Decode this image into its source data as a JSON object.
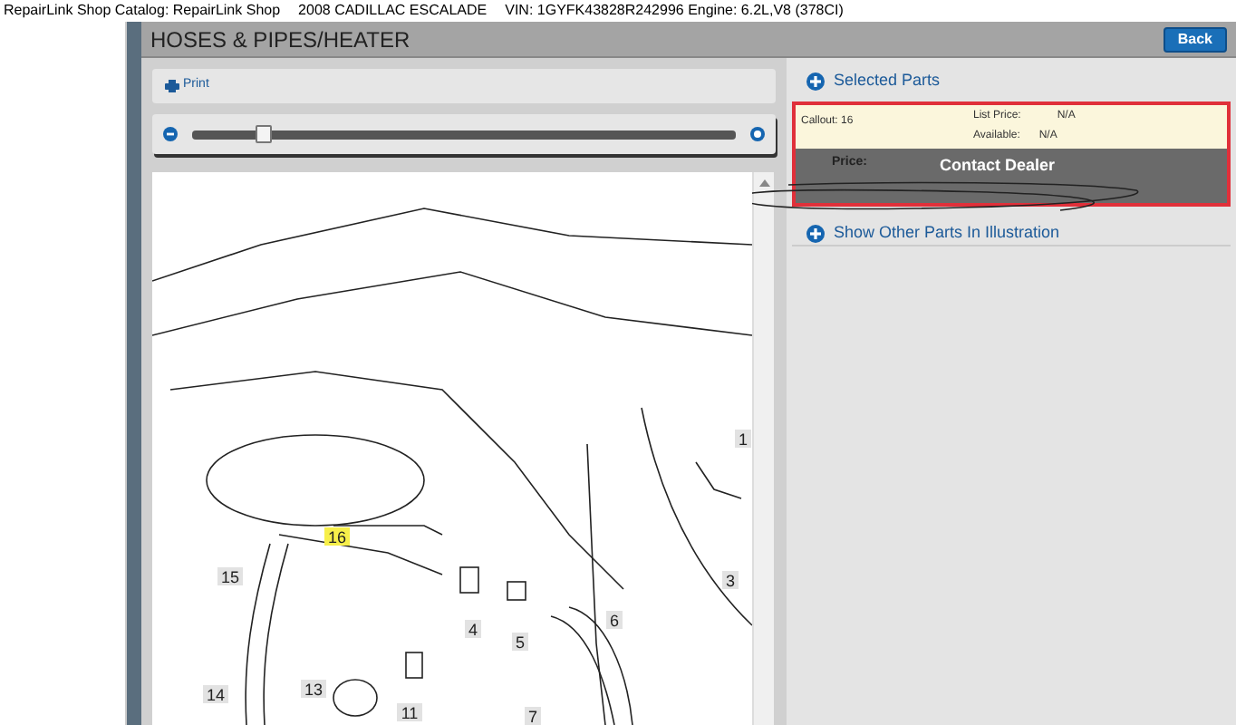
{
  "title_bar": {
    "catalog": "RepairLink Shop Catalog: RepairLink Shop",
    "vehicle": "2008 CADILLAC ESCALADE",
    "vin": "VIN: 1GYFK43828R242996 Engine: 6.2L,V8 (378CI)"
  },
  "header": {
    "title": "HOSES & PIPES/HEATER",
    "back_button": "Back"
  },
  "toolbar": {
    "print": "Print"
  },
  "zoom_slider": {
    "level": 0.13
  },
  "callouts": [
    {
      "label": "1",
      "highlighted": false
    },
    {
      "label": "16",
      "highlighted": true
    },
    {
      "label": "15",
      "highlighted": false
    },
    {
      "label": "3",
      "highlighted": false
    },
    {
      "label": "4",
      "highlighted": false
    },
    {
      "label": "5",
      "highlighted": false
    },
    {
      "label": "6",
      "highlighted": false
    },
    {
      "label": "14",
      "highlighted": false
    },
    {
      "label": "13",
      "highlighted": false
    },
    {
      "label": "11",
      "highlighted": false
    },
    {
      "label": "7",
      "highlighted": false
    }
  ],
  "selected_parts": {
    "heading": "Selected Parts",
    "callout": "Callout: 16",
    "list_price_label": "List Price:",
    "list_price": "N/A",
    "available_label": "Available:",
    "available": "N/A",
    "price_label": "Price:",
    "price": "Contact Dealer",
    "outlined": true
  },
  "other_parts": {
    "heading": "Show Other Parts In Illustration",
    "expanded": false
  }
}
